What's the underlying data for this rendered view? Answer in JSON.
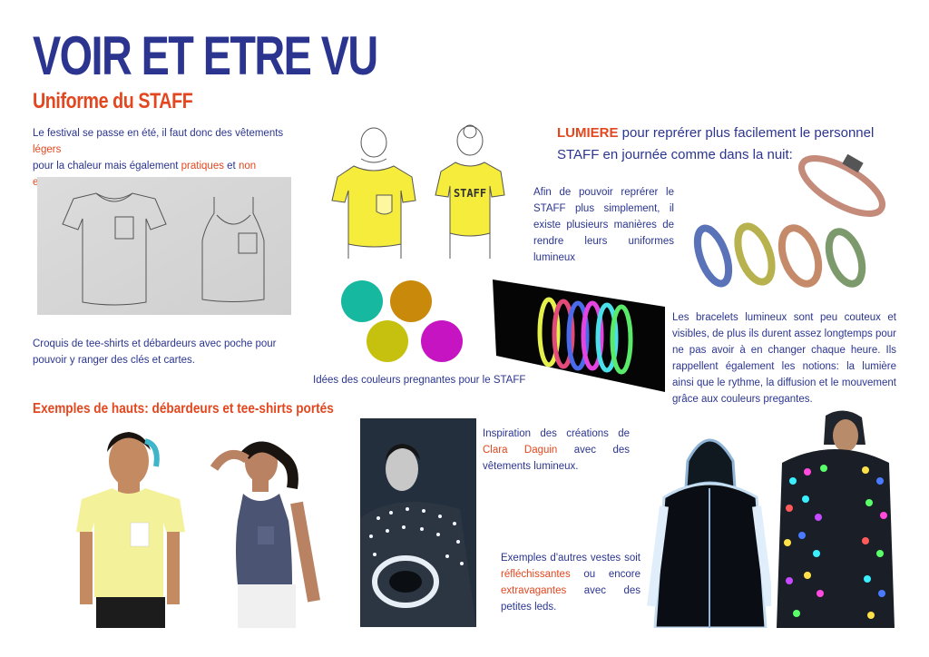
{
  "title": "VOIR ET ETRE VU",
  "subtitle": "Uniforme du STAFF",
  "intro": {
    "line1_before": "Le festival se passe en été, il faut donc des vêtements ",
    "word_legers": "légers",
    "line2_before": "pour la chaleur mais également ",
    "word_pratiques": "pratiques",
    "word_et": " et ",
    "word_non_encombrants": "non encombrants",
    "period": "."
  },
  "sketch_caption": "Croquis de tee-shirts et débardeurs avec poche pour pouvoir y ranger des clés et cartes.",
  "staff_print": "STAFF",
  "colors_caption": "Idées des couleurs pregnantes pour le STAFF",
  "palette": [
    "#16b8a0",
    "#c98a0c",
    "#c6c00e",
    "#c614c2"
  ],
  "examples_heading": "Exemples de hauts: débardeurs et tee-shirts portés",
  "lumiere": {
    "word": "LUMIERE",
    "rest": " pour reprérer plus facilement le personnel STAFF en journée comme dans la nuit:"
  },
  "find_staff_text": "Afin de pouvoir reprérer le STAFF plus simplement, il existe plusieurs manières de rendre leurs uniformes lumineux",
  "bracelets_text": "Les bracelets lumineux sont peu couteux et visibles, de plus ils durent assez longtemps pour ne pas avoir à en changer chaque heure. Ils rappellent également les notions: la lumière ainsi que le rythme, la diffusion et le mouvement grâce aux couleurs pregantes.",
  "inspiration": {
    "before": "Inspiration des créations de ",
    "name": "Clara Daguin",
    "after": " avec des vêtements lumineux."
  },
  "jackets": {
    "before": "Exemples d'autres vestes soit ",
    "word1": "réfléchissantes",
    "middle": " ou encore ",
    "word2": "extravagantes",
    "after": " avec des petites leds."
  }
}
